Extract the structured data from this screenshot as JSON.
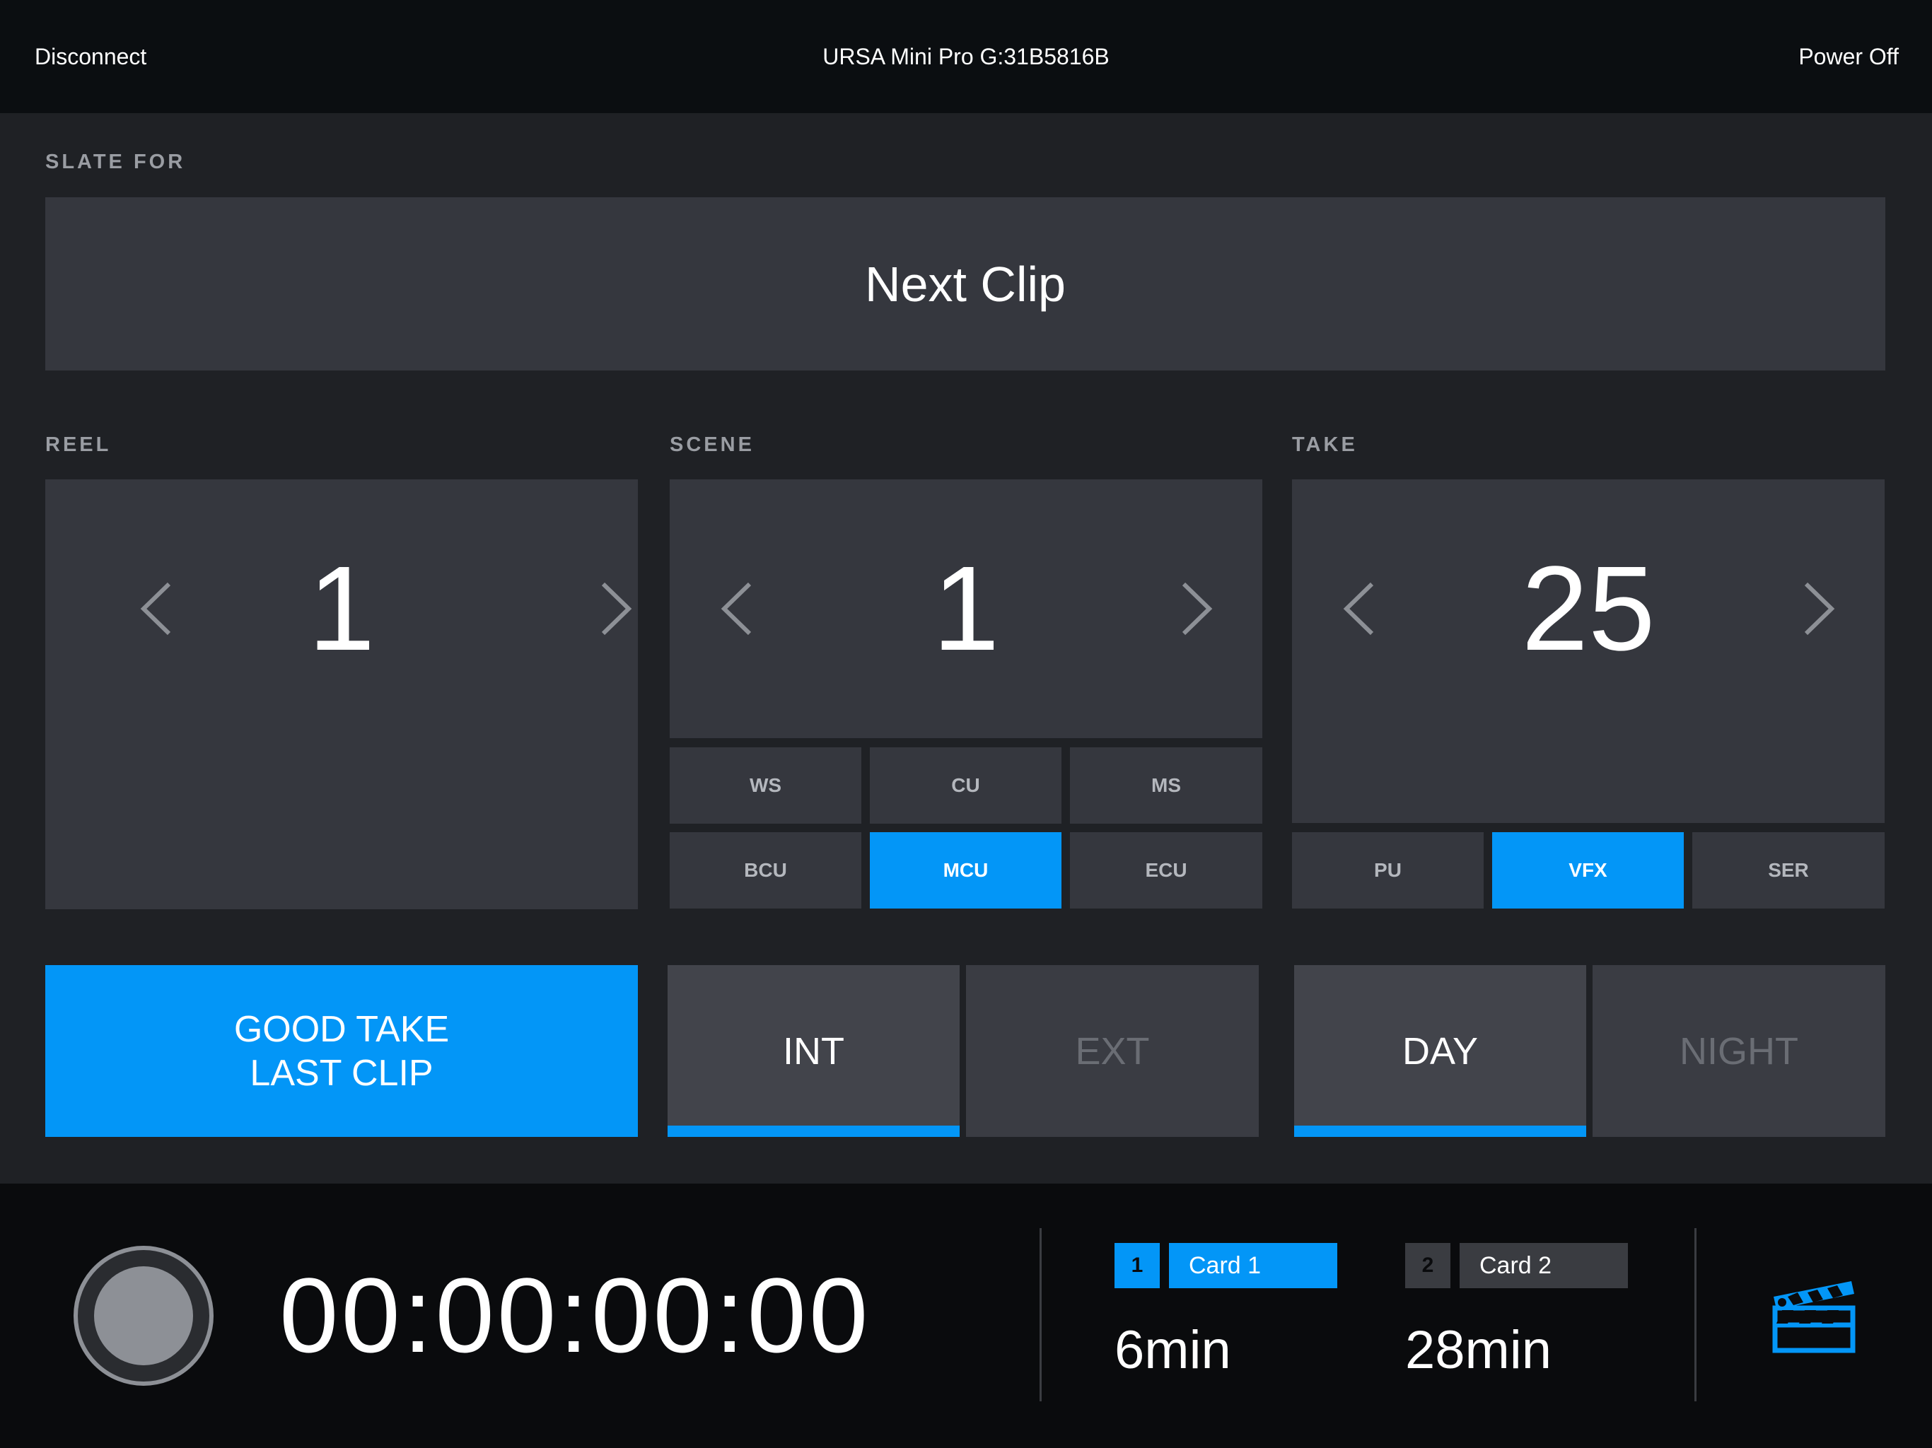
{
  "topbar": {
    "left_label": "Disconnect",
    "title": "URSA Mini Pro G:31B5816B",
    "right_label": "Power Off"
  },
  "slate": {
    "label": "SLATE FOR",
    "value": "Next Clip"
  },
  "reel": {
    "label": "REEL",
    "value": "1"
  },
  "scene": {
    "label": "SCENE",
    "value": "1",
    "shot_types": [
      "WS",
      "CU",
      "MS",
      "BCU",
      "MCU",
      "ECU"
    ],
    "active_shot": "MCU"
  },
  "take": {
    "label": "TAKE",
    "value": "25",
    "tags": [
      "PU",
      "VFX",
      "SER"
    ],
    "active_tag": "VFX"
  },
  "good_take": {
    "line1": "GOOD TAKE",
    "line2": "LAST CLIP"
  },
  "interior": {
    "int_label": "INT",
    "ext_label": "EXT",
    "selected": "INT"
  },
  "time_of_day": {
    "day_label": "DAY",
    "night_label": "NIGHT",
    "selected": "DAY"
  },
  "recording": {
    "timecode": "00:00:00:00"
  },
  "cards": [
    {
      "number": "1",
      "name": "Card 1",
      "remaining": "6min",
      "active": true
    },
    {
      "number": "2",
      "name": "Card 2",
      "remaining": "28min",
      "active": false
    }
  ],
  "colors": {
    "accent": "#0396f7",
    "background": "#1f2125",
    "panel": "#35373e",
    "bar": "#0b0e11"
  },
  "icons": {
    "slate_icon": "clapperboard-icon",
    "prev": "chevron-left-icon",
    "next": "chevron-right-icon"
  }
}
